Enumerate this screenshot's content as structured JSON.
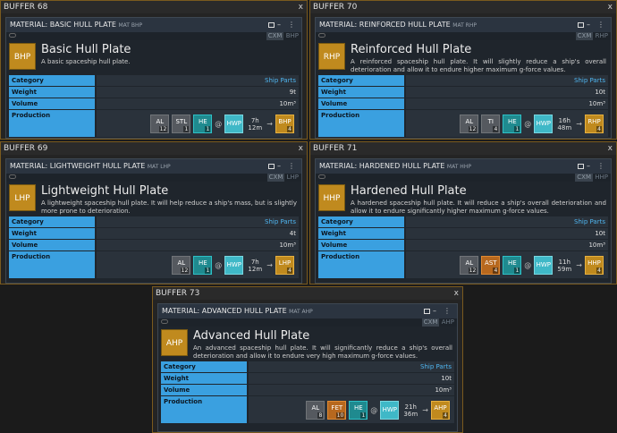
{
  "buffers": [
    {
      "title": "BUFFER 68",
      "close": "x",
      "material_title": "MATERIAL: BASIC HULL PLATE",
      "material_tag": "MAT BHP",
      "cxm": "CXM",
      "cxm_ticker": "BHP",
      "ticker": "BHP",
      "name": "Basic Hull Plate",
      "description": "A basic spaceship hull plate.",
      "category_label": "Category",
      "category": "Ship Parts",
      "weight_label": "Weight",
      "weight": "9t",
      "volume_label": "Volume",
      "volume": "10m³",
      "production_label": "Production",
      "inputs": [
        {
          "ticker": "AL",
          "qty": "12",
          "style": "grey"
        },
        {
          "ticker": "STL",
          "qty": "1",
          "style": "grey"
        },
        {
          "ticker": "HE",
          "qty": "1",
          "style": "teal"
        }
      ],
      "at": "@",
      "building": "HWP",
      "time": "7h 12m",
      "arrow": "→",
      "output": {
        "ticker": "BHP",
        "qty": "4"
      }
    },
    {
      "title": "BUFFER 70",
      "close": "x",
      "material_title": "MATERIAL: REINFORCED HULL PLATE",
      "material_tag": "MAT RHP",
      "cxm": "CXM",
      "cxm_ticker": "RHP",
      "ticker": "RHP",
      "name": "Reinforced Hull Plate",
      "description": "A reinforced spaceship hull plate. It will slightly reduce a ship's overall deterioration and allow it to endure higher maximum g-force values.",
      "category_label": "Category",
      "category": "Ship Parts",
      "weight_label": "Weight",
      "weight": "10t",
      "volume_label": "Volume",
      "volume": "10m³",
      "production_label": "Production",
      "inputs": [
        {
          "ticker": "AL",
          "qty": "12",
          "style": "grey"
        },
        {
          "ticker": "TI",
          "qty": "4",
          "style": "grey"
        },
        {
          "ticker": "HE",
          "qty": "1",
          "style": "teal"
        }
      ],
      "at": "@",
      "building": "HWP",
      "time": "16h 48m",
      "arrow": "→",
      "output": {
        "ticker": "RHP",
        "qty": "4"
      }
    },
    {
      "title": "BUFFER 69",
      "close": "x",
      "material_title": "MATERIAL: LIGHTWEIGHT HULL PLATE",
      "material_tag": "MAT LHP",
      "cxm": "CXM",
      "cxm_ticker": "LHP",
      "ticker": "LHP",
      "name": "Lightweight Hull Plate",
      "description": "A lightweight spaceship hull plate. It will help reduce a ship's mass, but is slightly more prone to deterioration.",
      "category_label": "Category",
      "category": "Ship Parts",
      "weight_label": "Weight",
      "weight": "4t",
      "volume_label": "Volume",
      "volume": "10m³",
      "production_label": "Production",
      "inputs": [
        {
          "ticker": "AL",
          "qty": "12",
          "style": "grey"
        },
        {
          "ticker": "HE",
          "qty": "1",
          "style": "teal"
        }
      ],
      "at": "@",
      "building": "HWP",
      "time": "7h 12m",
      "arrow": "→",
      "output": {
        "ticker": "LHP",
        "qty": "4"
      }
    },
    {
      "title": "BUFFER 71",
      "close": "x",
      "material_title": "MATERIAL: HARDENED HULL PLATE",
      "material_tag": "MAT HHP",
      "cxm": "CXM",
      "cxm_ticker": "HHP",
      "ticker": "HHP",
      "name": "Hardened Hull Plate",
      "description": "A hardened spaceship hull plate. It will reduce a ship's overall deterioration and allow it to endure significantly higher maximum g-force values.",
      "category_label": "Category",
      "category": "Ship Parts",
      "weight_label": "Weight",
      "weight": "10t",
      "volume_label": "Volume",
      "volume": "10m³",
      "production_label": "Production",
      "inputs": [
        {
          "ticker": "AL",
          "qty": "12",
          "style": "grey"
        },
        {
          "ticker": "AST",
          "qty": "4",
          "style": "orange"
        },
        {
          "ticker": "HE",
          "qty": "1",
          "style": "teal"
        }
      ],
      "at": "@",
      "building": "HWP",
      "time": "11h 59m",
      "arrow": "→",
      "output": {
        "ticker": "HHP",
        "qty": "4"
      }
    },
    {
      "title": "BUFFER 73",
      "close": "x",
      "material_title": "MATERIAL: ADVANCED HULL PLATE",
      "material_tag": "MAT AHP",
      "cxm": "CXM",
      "cxm_ticker": "AHP",
      "ticker": "AHP",
      "name": "Advanced Hull Plate",
      "description": "An advanced spaceship hull plate. It will significantly reduce a ship's overall deterioration and allow it to endure very high maximum g-force values.",
      "category_label": "Category",
      "category": "Ship Parts",
      "weight_label": "Weight",
      "weight": "10t",
      "volume_label": "Volume",
      "volume": "10m³",
      "production_label": "Production",
      "inputs": [
        {
          "ticker": "AL",
          "qty": "8",
          "style": "grey"
        },
        {
          "ticker": "FET",
          "qty": "10",
          "style": "orange"
        },
        {
          "ticker": "HE",
          "qty": "1",
          "style": "teal"
        }
      ],
      "at": "@",
      "building": "HWP",
      "time": "21h 36m",
      "arrow": "→",
      "output": {
        "ticker": "AHP",
        "qty": "4"
      }
    }
  ]
}
